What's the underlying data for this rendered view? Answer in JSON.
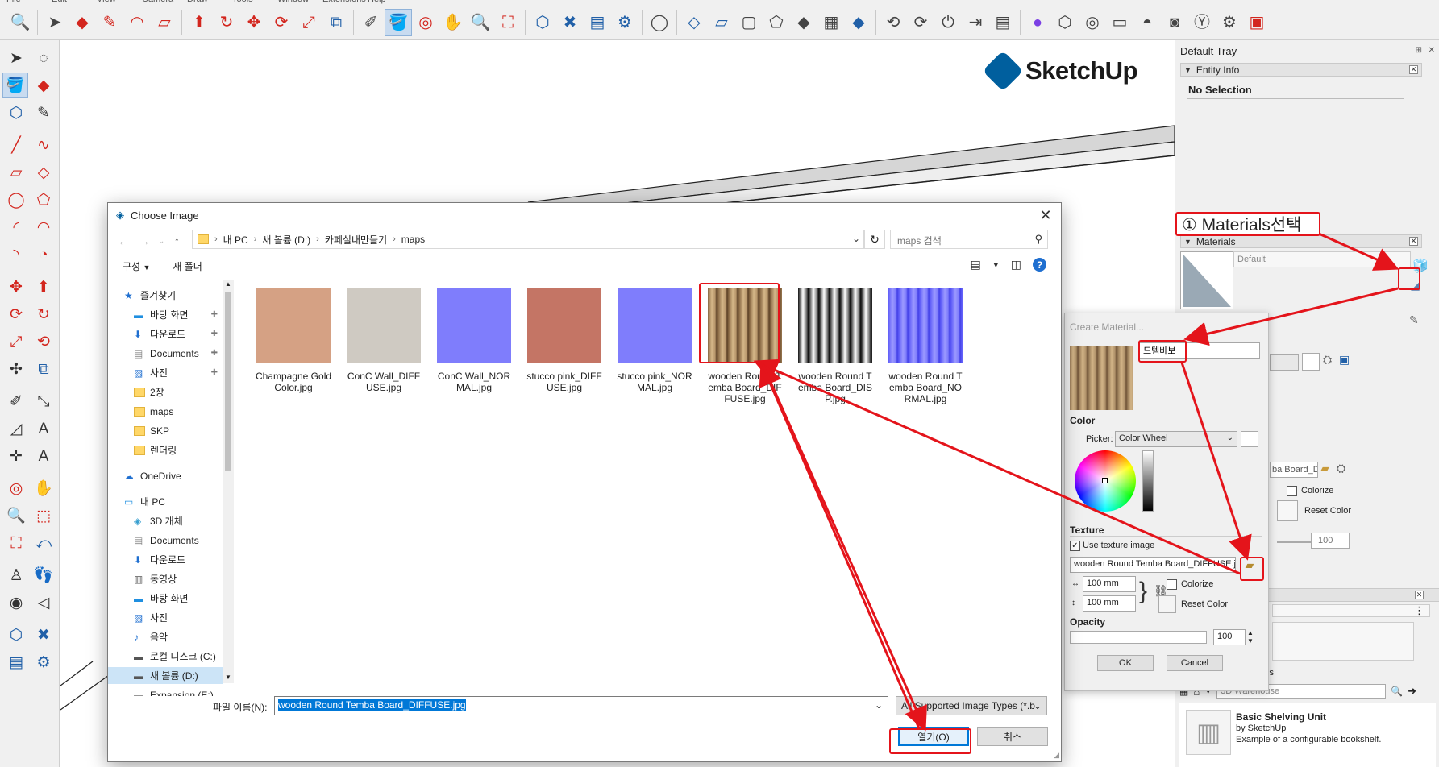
{
  "app": {
    "logo_text": "SketchUp",
    "menu": [
      "File",
      "Edit",
      "View",
      "Camera",
      "Draw",
      "Tools",
      "Window",
      "Extensions",
      "Help"
    ]
  },
  "tray": {
    "title": "Default Tray",
    "entity_info": {
      "header": "Entity Info",
      "selection": "No Selection"
    },
    "materials": {
      "header": "Materials",
      "current": "Default"
    },
    "edit_partial": {
      "texture_file_partial": "ba Board_D",
      "colorize_label": "Colorize",
      "reset_color_label": "Reset Color",
      "opacity_value": "100"
    },
    "tab_partial": "stics",
    "warehouse": {
      "search_placeholder": "3D Warehouse",
      "item_title": "Basic Shelving Unit",
      "item_author": "by SketchUp",
      "item_desc": "Example of a configurable bookshelf."
    }
  },
  "annotation": {
    "step_label": "① Materials선택"
  },
  "create_material": {
    "title": "Create Material...",
    "name_value": "드템바보",
    "color_label": "Color",
    "picker_label": "Picker:",
    "picker_value": "Color Wheel",
    "texture_label": "Texture",
    "use_texture_label": "Use texture image",
    "texture_file": "wooden Round Temba Board_DIFFUSE.jpg",
    "width_value": "100 mm",
    "height_value": "100 mm",
    "colorize_label": "Colorize",
    "reset_color_label": "Reset Color",
    "opacity_label": "Opacity",
    "opacity_value": "100",
    "ok_label": "OK",
    "cancel_label": "Cancel"
  },
  "dialog": {
    "title": "Choose Image",
    "path": [
      "내 PC",
      "새 볼륨 (D:)",
      "카페실내만들기",
      "maps"
    ],
    "search_placeholder": "maps 검색",
    "organize_label": "구성",
    "new_folder_label": "새 폴더",
    "nav": [
      {
        "label": "즐겨찾기",
        "kind": "star"
      },
      {
        "label": "바탕 화면",
        "kind": "desk",
        "pinned": true
      },
      {
        "label": "다운로드",
        "kind": "down",
        "pinned": true
      },
      {
        "label": "Documents",
        "kind": "doc",
        "pinned": true
      },
      {
        "label": "사진",
        "kind": "pic",
        "pinned": true
      },
      {
        "label": "2장",
        "kind": "folder"
      },
      {
        "label": "maps",
        "kind": "folder"
      },
      {
        "label": "SKP",
        "kind": "folder"
      },
      {
        "label": "렌더링",
        "kind": "folder"
      },
      {
        "label": "OneDrive",
        "kind": "cloud"
      },
      {
        "label": "내 PC",
        "kind": "pc"
      },
      {
        "label": "3D 개체",
        "kind": "obj"
      },
      {
        "label": "Documents",
        "kind": "doc"
      },
      {
        "label": "다운로드",
        "kind": "down"
      },
      {
        "label": "동영상",
        "kind": "video"
      },
      {
        "label": "바탕 화면",
        "kind": "desk"
      },
      {
        "label": "사진",
        "kind": "pic"
      },
      {
        "label": "음악",
        "kind": "music"
      },
      {
        "label": "로컬 디스크 (C:)",
        "kind": "drive"
      },
      {
        "label": "새 볼륨 (D:)",
        "kind": "drive",
        "selected": true
      },
      {
        "label": "Expansion (E:)",
        "kind": "drive"
      }
    ],
    "files": [
      {
        "name": "Champagne Gold Color.jpg",
        "tex": "champ"
      },
      {
        "name": "ConC Wall_DIFFUSE.jpg",
        "tex": "conc"
      },
      {
        "name": "ConC Wall_NORMAL.jpg",
        "tex": "normal"
      },
      {
        "name": "stucco pink_DIFFUSE.jpg",
        "tex": "stucco"
      },
      {
        "name": "stucco pink_NORMAL.jpg",
        "tex": "normal"
      },
      {
        "name": "wooden Round Temba Board_DIFFUSE.jpg",
        "tex": "wood",
        "selected": true
      },
      {
        "name": "wooden Round Temba Board_DISP.jpg",
        "tex": "disp"
      },
      {
        "name": "wooden Round Temba Board_NORMAL.jpg",
        "tex": "woodnormal"
      }
    ],
    "filename_label": "파일 이름(N):",
    "filename_value": "wooden Round Temba Board_DIFFUSE.jpg",
    "filetype_value": "All Supported Image Types (*.b",
    "open_label": "열기(O)",
    "cancel_label": "취소"
  }
}
